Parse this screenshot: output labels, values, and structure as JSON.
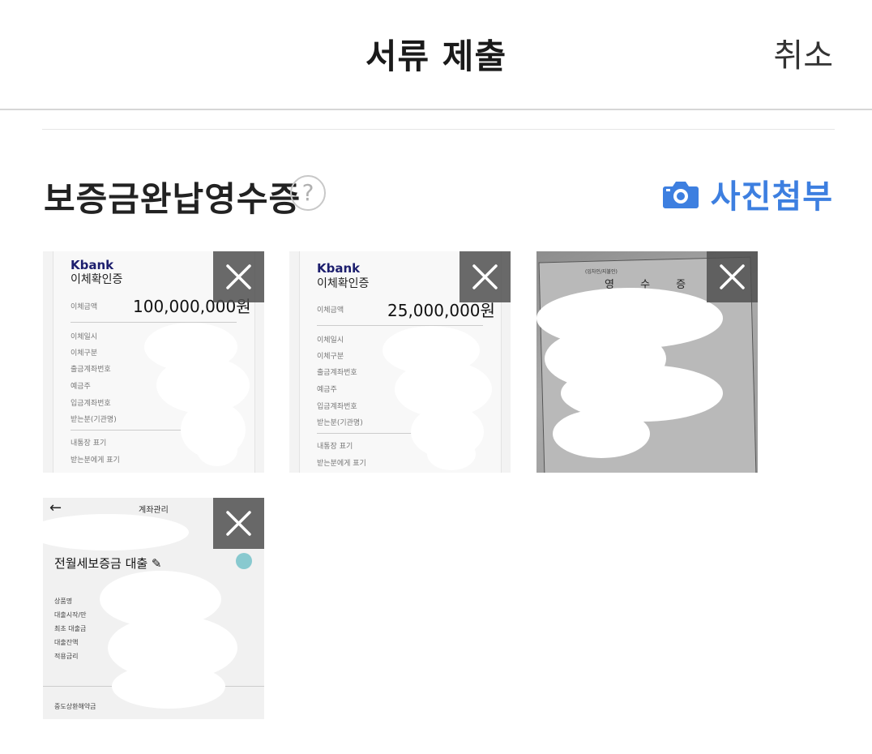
{
  "header": {
    "title": "서류 제출",
    "cancel_label": "취소"
  },
  "section": {
    "title": "보증금완납영수증",
    "help_symbol": "?",
    "attach_label": "사진첨부",
    "attach_icon": "camera-icon",
    "accent_color": "#3d7fe0"
  },
  "thumbnails": {
    "t1": {
      "brand": "Kbank",
      "title": "이체확인증",
      "amount_label": "이체금액",
      "amount": "100,000,000원",
      "fields": [
        "이체일시",
        "이체구분",
        "출금계좌번호",
        "예금주",
        "입금계좌번호",
        "받는분(기관명)",
        "내통장 표기",
        "받는분에게 표기"
      ]
    },
    "t2": {
      "brand": "Kbank",
      "title": "이체확인증",
      "amount_label": "이체금액",
      "amount": "25,000,000원",
      "fields": [
        "이체일시",
        "이체구분",
        "출금계좌번호",
        "예금주",
        "입금계좌번호",
        "받는분(기관명)",
        "내통장 표기",
        "받는분에게 표기"
      ]
    },
    "t3": {
      "head": "영 수 증",
      "small": "(임차인/지불인)"
    },
    "t4": {
      "back": "←",
      "title": "계좌관리",
      "product": "전월세보증금 대출 ✎",
      "fields": [
        "상품명",
        "대출시작/만",
        "최초 대출금",
        "대출잔액",
        "적용금리",
        "중도상환해약금"
      ]
    }
  }
}
